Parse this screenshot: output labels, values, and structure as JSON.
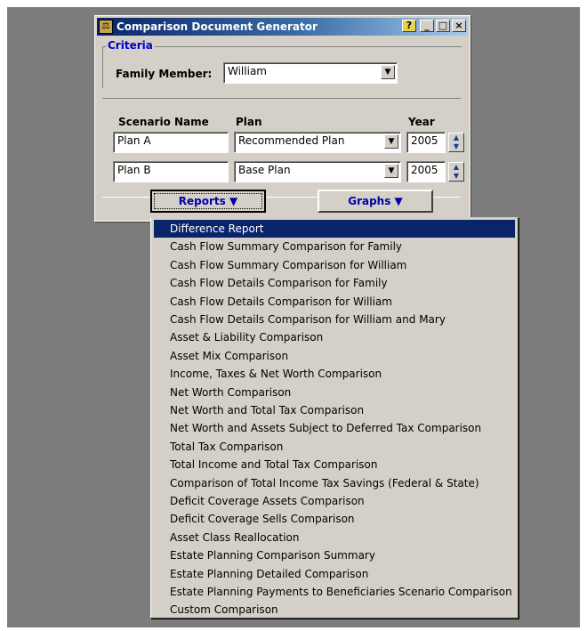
{
  "window": {
    "title": "Comparison Document Generator"
  },
  "criteria": {
    "legend": "Criteria",
    "family_label": "Family Member:",
    "family_value": "William"
  },
  "columns": {
    "scenario": "Scenario Name",
    "plan": "Plan",
    "year": "Year"
  },
  "scenarios": [
    {
      "name": "Plan A",
      "plan": "Recommended Plan",
      "year": "2005"
    },
    {
      "name": "Plan B",
      "plan": "Base Plan",
      "year": "2005"
    }
  ],
  "buttons": {
    "reports": "Reports ▼",
    "graphs": "Graphs ▼"
  },
  "menu": {
    "selected_index": 0,
    "items": [
      "Difference Report",
      "Cash Flow Summary Comparison for Family",
      "Cash Flow Summary Comparison for William",
      "Cash Flow Details Comparison for Family",
      "Cash Flow Details Comparison for William",
      "Cash Flow Details Comparison for William and Mary",
      "Asset & Liability Comparison",
      "Asset Mix Comparison",
      "Income, Taxes & Net Worth Comparison",
      "Net Worth Comparison",
      "Net Worth and Total Tax Comparison",
      "Net Worth and Assets Subject to Deferred Tax Comparison",
      "Total Tax Comparison",
      "Total Income and Total Tax Comparison",
      "Comparison of Total Income Tax Savings (Federal & State)",
      "Deficit Coverage Assets Comparison",
      "Deficit Coverage Sells Comparison",
      "Asset Class Reallocation",
      "Estate Planning Comparison Summary",
      "Estate Planning Detailed Comparison",
      "Estate Planning Payments to Beneficiaries Scenario Comparison",
      "Custom Comparison"
    ]
  }
}
